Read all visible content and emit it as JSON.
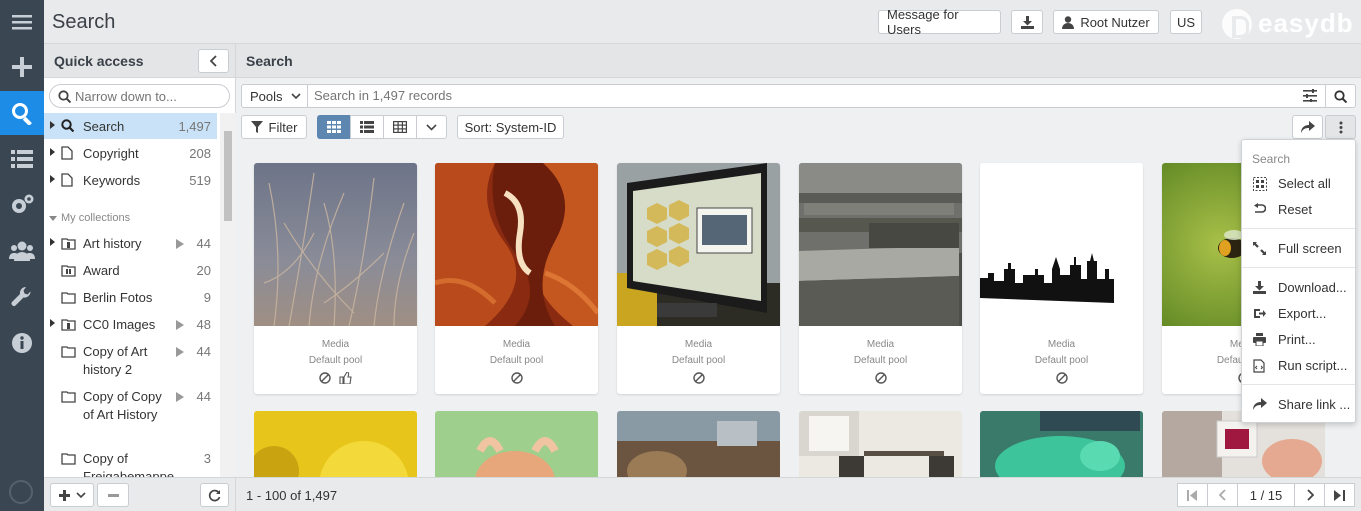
{
  "header": {
    "title": "Search",
    "message_btn": "Message for Users",
    "user_btn": "Root Nutzer",
    "lang_btn": "US",
    "brand": "easydb"
  },
  "rail": {
    "items": [
      "menu-icon",
      "add-icon",
      "search-icon",
      "list-icon",
      "gears-icon",
      "users-icon",
      "wrench-icon",
      "info-icon"
    ]
  },
  "sidebar": {
    "title": "Quick access",
    "search_placeholder": "Narrow down to...",
    "top_items": [
      {
        "label": "Search",
        "count": "1,497"
      },
      {
        "label": "Copyright",
        "count": "208"
      },
      {
        "label": "Keywords",
        "count": "519"
      }
    ],
    "section": "My collections",
    "collections": [
      {
        "label": "Art history",
        "count": "44"
      },
      {
        "label": "Award",
        "count": "20"
      },
      {
        "label": "Berlin Fotos",
        "count": "9"
      },
      {
        "label": "CC0 Images",
        "count": "48"
      },
      {
        "label": "Copy of Art history 2",
        "count": "44"
      },
      {
        "label": "Copy of Copy of Art History",
        "count": "44"
      },
      {
        "label": "Copy of Freigabemappe",
        "count": "3"
      }
    ]
  },
  "main": {
    "title": "Search",
    "pools_label": "Pools",
    "search_placeholder": "Search in 1,497 records",
    "filter_label": "Filter",
    "sort_label": "Sort: System-ID",
    "footer_text": "1 - 100 of 1,497",
    "page_indicator": "1 / 15"
  },
  "cards": [
    {
      "type": "Media",
      "pool": "Default pool"
    },
    {
      "type": "Media",
      "pool": "Default pool"
    },
    {
      "type": "Media",
      "pool": "Default pool"
    },
    {
      "type": "Media",
      "pool": "Default pool"
    },
    {
      "type": "Media",
      "pool": "Default pool"
    },
    {
      "type": "Media",
      "pool": "Default pool"
    }
  ],
  "menu": {
    "heading": "Search",
    "items": [
      {
        "label": "Select all",
        "icon": "select-all-icon"
      },
      {
        "label": "Reset",
        "icon": "reset-icon"
      },
      {
        "label": "Full screen",
        "icon": "fullscreen-icon"
      },
      {
        "label": "Download...",
        "icon": "download-icon"
      },
      {
        "label": "Export...",
        "icon": "export-icon"
      },
      {
        "label": "Print...",
        "icon": "print-icon"
      },
      {
        "label": "Run script...",
        "icon": "script-icon"
      },
      {
        "label": "Share link ...",
        "icon": "share-icon"
      }
    ]
  },
  "colors": {
    "accent": "#1d8ce6",
    "rail": "#3a4652",
    "selected": "#c9e2f7"
  }
}
